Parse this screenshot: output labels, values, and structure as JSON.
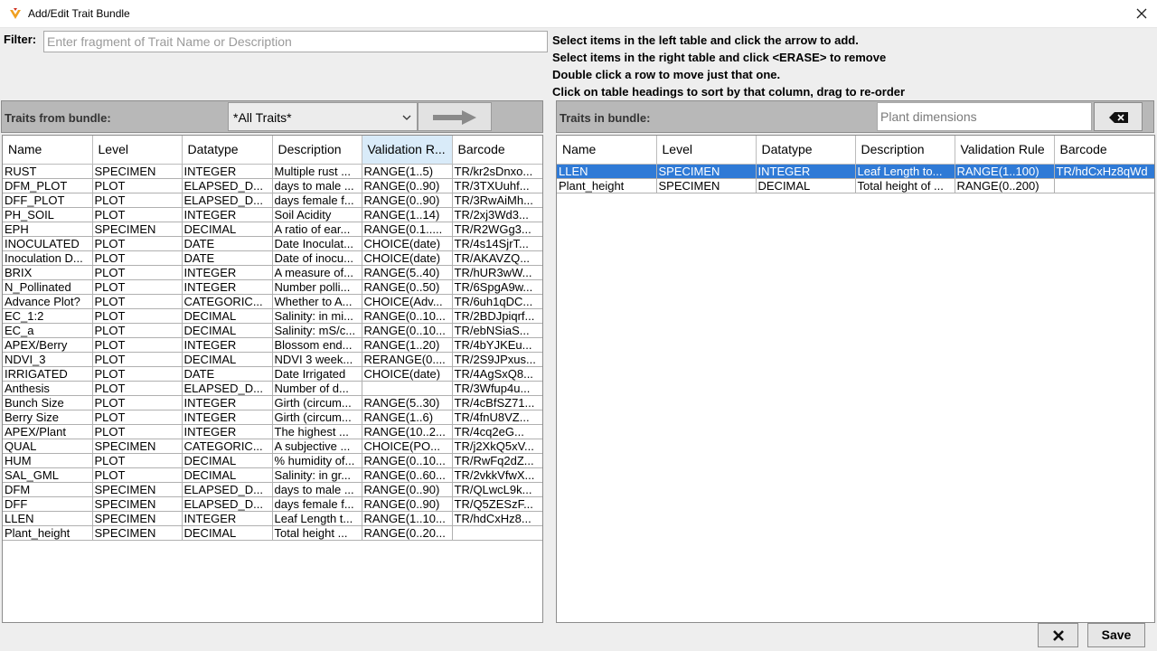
{
  "window": {
    "title": "Add/Edit Trait Bundle"
  },
  "filter": {
    "label": "Filter:",
    "value": "",
    "placeholder": "Enter fragment of Trait Name or Description"
  },
  "instructions": [
    "Select items in the left table and click the arrow to add.",
    "Select items in the right table and click <ERASE> to remove",
    "Double click a row to move just that one.",
    "Click on table headings to sort by that column, drag to re-order"
  ],
  "left_panel": {
    "label": "Traits from bundle:",
    "bundle_select": "*All Traits*",
    "columns": [
      "Name",
      "Level",
      "Datatype",
      "Description",
      "Validation R...",
      "Barcode"
    ],
    "rows": [
      [
        "RUST",
        "SPECIMEN",
        "INTEGER",
        "Multiple rust ...",
        "RANGE(1..5)",
        "TR/kr2sDnxo..."
      ],
      [
        "DFM_PLOT",
        "PLOT",
        "ELAPSED_D...",
        "days to male ...",
        "RANGE(0..90)",
        "TR/3TXUuhf..."
      ],
      [
        "DFF_PLOT",
        "PLOT",
        "ELAPSED_D...",
        "days female f...",
        "RANGE(0..90)",
        "TR/3RwAiMh..."
      ],
      [
        "PH_SOIL",
        "PLOT",
        "INTEGER",
        "Soil Acidity",
        "RANGE(1..14)",
        "TR/2xj3Wd3..."
      ],
      [
        "EPH",
        "SPECIMEN",
        "DECIMAL",
        "A ratio of ear...",
        "RANGE(0.1.....",
        "TR/R2WGg3..."
      ],
      [
        "INOCULATED",
        "PLOT",
        "DATE",
        "Date Inoculat...",
        "CHOICE(date)",
        "TR/4s14SjrT..."
      ],
      [
        "Inoculation D...",
        "PLOT",
        "DATE",
        "Date of inocu...",
        "CHOICE(date)",
        "TR/AKAVZQ..."
      ],
      [
        "BRIX",
        "PLOT",
        "INTEGER",
        "A measure of...",
        "RANGE(5..40)",
        "TR/hUR3wW..."
      ],
      [
        "N_Pollinated",
        "PLOT",
        "INTEGER",
        "Number polli...",
        "RANGE(0..50)",
        "TR/6SpgA9w..."
      ],
      [
        "Advance Plot?",
        "PLOT",
        "CATEGORIC...",
        "Whether to A...",
        "CHOICE(Adv...",
        "TR/6uh1qDC..."
      ],
      [
        "EC_1:2",
        "PLOT",
        "DECIMAL",
        "Salinity: in mi...",
        "RANGE(0..10...",
        "TR/2BDJpiqrf..."
      ],
      [
        "EC_a",
        "PLOT",
        "DECIMAL",
        "Salinity: mS/c...",
        "RANGE(0..10...",
        "TR/ebNSiaS..."
      ],
      [
        "APEX/Berry",
        "PLOT",
        "INTEGER",
        "Blossom end...",
        "RANGE(1..20)",
        "TR/4bYJKEu..."
      ],
      [
        "NDVI_3",
        "PLOT",
        "DECIMAL",
        "NDVI 3 week...",
        "RERANGE(0....",
        "TR/2S9JPxus..."
      ],
      [
        "IRRIGATED",
        "PLOT",
        "DATE",
        "Date Irrigated",
        "CHOICE(date)",
        "TR/4AgSxQ8..."
      ],
      [
        "Anthesis",
        "PLOT",
        "ELAPSED_D...",
        "Number of d...",
        "",
        "TR/3Wfup4u..."
      ],
      [
        "Bunch Size",
        "PLOT",
        "INTEGER",
        "Girth (circum...",
        "RANGE(5..30)",
        "TR/4cBfSZ71..."
      ],
      [
        "Berry Size",
        "PLOT",
        "INTEGER",
        "Girth (circum...",
        "RANGE(1..6)",
        "TR/4fnU8VZ..."
      ],
      [
        "APEX/Plant",
        "PLOT",
        "INTEGER",
        "The highest ...",
        "RANGE(10..2...",
        "TR/4cq2eG..."
      ],
      [
        "QUAL",
        "SPECIMEN",
        "CATEGORIC...",
        "A subjective ...",
        "CHOICE(PO...",
        "TR/j2XkQ5xV..."
      ],
      [
        "HUM",
        "PLOT",
        "DECIMAL",
        "% humidity of...",
        "RANGE(0..10...",
        "TR/RwFq2dZ..."
      ],
      [
        "SAL_GML",
        "PLOT",
        "DECIMAL",
        "Salinity: in gr...",
        "RANGE(0..60...",
        "TR/2vkkVfwX..."
      ],
      [
        "DFM",
        "SPECIMEN",
        "ELAPSED_D...",
        "days to male ...",
        "RANGE(0..90)",
        "TR/QLwcL9k..."
      ],
      [
        "DFF",
        "SPECIMEN",
        "ELAPSED_D...",
        "days female f...",
        "RANGE(0..90)",
        "TR/Q5ZESzF..."
      ],
      [
        "LLEN",
        "SPECIMEN",
        "INTEGER",
        "Leaf Length t...",
        "RANGE(1..10...",
        "TR/hdCxHz8..."
      ],
      [
        "Plant_height",
        "SPECIMEN",
        "DECIMAL",
        "Total height ...",
        "RANGE(0..20...",
        ""
      ]
    ]
  },
  "right_panel": {
    "label": "Traits in bundle:",
    "bundle_name_value": "",
    "bundle_name_placeholder": "Plant dimensions",
    "columns": [
      "Name",
      "Level",
      "Datatype",
      "Description",
      "Validation Rule",
      "Barcode"
    ],
    "rows": [
      [
        "LLEN",
        "SPECIMEN",
        "INTEGER",
        "Leaf Length to...",
        "RANGE(1..100)",
        "TR/hdCxHz8qWd"
      ],
      [
        "Plant_height",
        "SPECIMEN",
        "DECIMAL",
        "Total height of ...",
        "RANGE(0..200)",
        ""
      ]
    ],
    "selected_row": 0
  },
  "buttons": {
    "cancel_icon": "x-icon",
    "save": "Save"
  },
  "icons": {
    "app": "app-logo-icon",
    "close": "close-icon",
    "add_arrow": "arrow-right-icon",
    "erase": "erase-icon",
    "dropdown": "chevron-down-icon"
  },
  "colors": {
    "selection": "#2f7ad6",
    "panel_header": "#b8b8b8",
    "sorted_header": "#d9ebf9"
  }
}
